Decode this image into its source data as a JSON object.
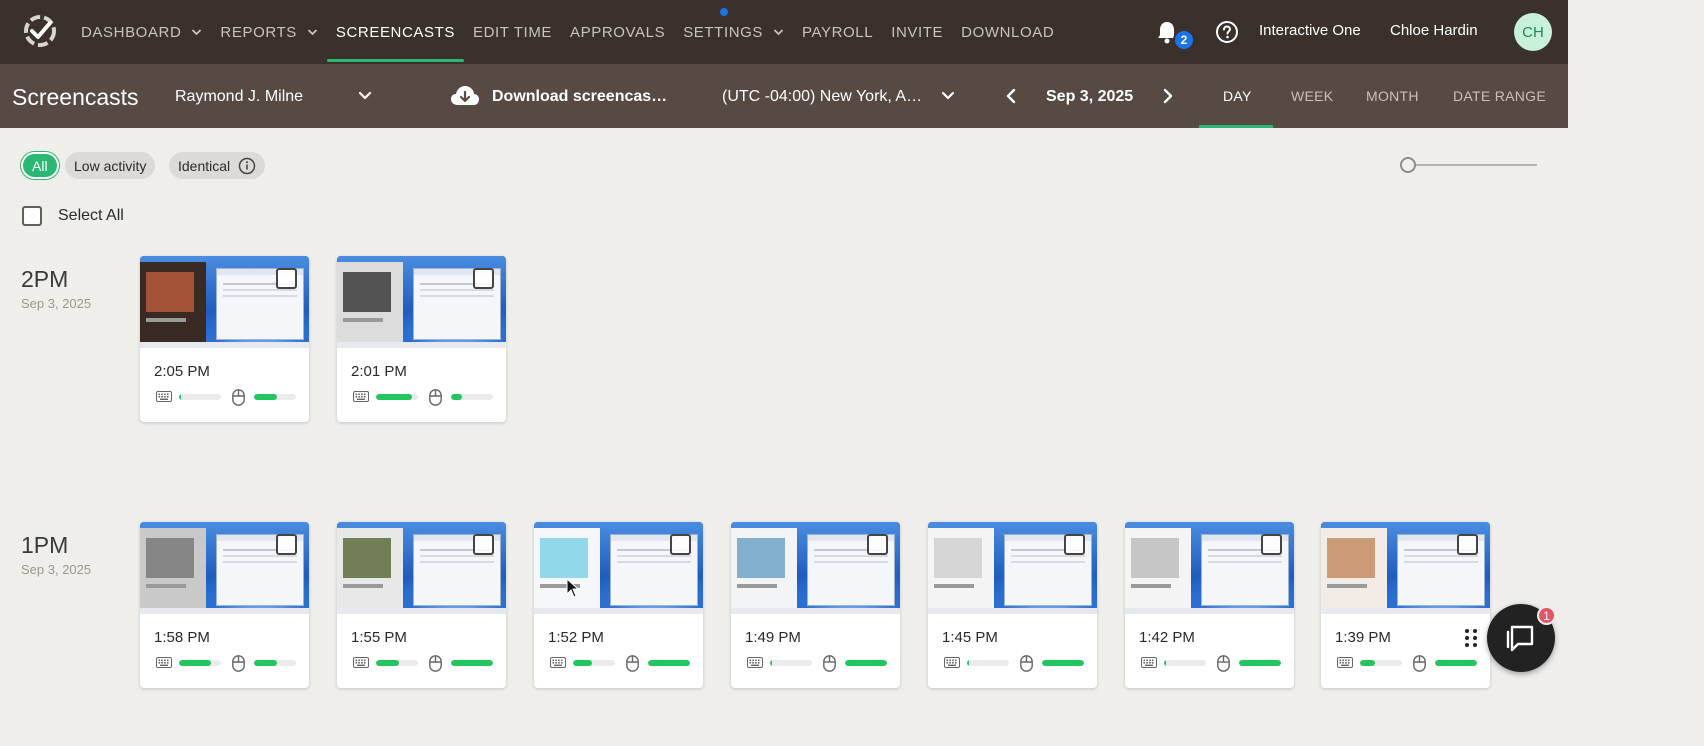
{
  "nav": {
    "items": [
      {
        "label": "DASHBOARD",
        "dropdown": true,
        "active": false
      },
      {
        "label": "REPORTS",
        "dropdown": true,
        "active": false
      },
      {
        "label": "SCREENCASTS",
        "dropdown": false,
        "active": true
      },
      {
        "label": "EDIT TIME",
        "dropdown": false,
        "active": false
      },
      {
        "label": "APPROVALS",
        "dropdown": false,
        "active": false
      },
      {
        "label": "SETTINGS",
        "dropdown": true,
        "active": false
      },
      {
        "label": "PAYROLL",
        "dropdown": false,
        "active": false
      },
      {
        "label": "INVITE",
        "dropdown": false,
        "active": false
      },
      {
        "label": "DOWNLOAD",
        "dropdown": false,
        "active": false
      }
    ],
    "notifications_count": "2",
    "organization": "Interactive One",
    "user_name": "Chloe Hardin",
    "avatar_initials": "CH"
  },
  "subheader": {
    "title": "Screencasts",
    "member": "Raymond J. Milne",
    "download_label": "Download screencas…",
    "timezone": "(UTC -04:00) New York, A…",
    "date": "Sep 3, 2025",
    "range_tabs": [
      "DAY",
      "WEEK",
      "MONTH",
      "DATE RANGE"
    ],
    "active_range": "DAY"
  },
  "filters": {
    "chips": [
      "All",
      "Low activity",
      "Identical"
    ],
    "active_chip": "All",
    "select_all_label": "Select All"
  },
  "groups": [
    {
      "hour": "2PM",
      "date": "Sep 3, 2025",
      "cards": [
        {
          "time": "2:05 PM",
          "keyboard": 0.05,
          "mouse": 0.55
        },
        {
          "time": "2:01 PM",
          "keyboard": 0.85,
          "mouse": 0.25
        }
      ]
    },
    {
      "hour": "1PM",
      "date": "Sep 3, 2025",
      "cards": [
        {
          "time": "1:58 PM",
          "keyboard": 0.75,
          "mouse": 0.55
        },
        {
          "time": "1:55 PM",
          "keyboard": 0.55,
          "mouse": 1.0
        },
        {
          "time": "1:52 PM",
          "keyboard": 0.45,
          "mouse": 1.0
        },
        {
          "time": "1:49 PM",
          "keyboard": 0.05,
          "mouse": 1.0
        },
        {
          "time": "1:45 PM",
          "keyboard": 0.05,
          "mouse": 1.0
        },
        {
          "time": "1:42 PM",
          "keyboard": 0.05,
          "mouse": 1.0
        },
        {
          "time": "1:39 PM",
          "keyboard": 0.35,
          "mouse": 1.0
        }
      ]
    }
  ],
  "chat": {
    "unread_count": "1"
  },
  "colors": {
    "nav_bg": "#3a302c",
    "subbar_bg": "#574a43",
    "accent_green": "#2bb673",
    "activity_green": "#22c55e",
    "badge_blue": "#1a73e8",
    "page_bg": "#efeeeb"
  },
  "icons": {
    "logo": "checkmark-gear-logo",
    "bell": "bell-icon",
    "help": "help-circle-icon",
    "download": "cloud-download-icon",
    "keyboard": "keyboard-icon",
    "mouse": "mouse-icon",
    "chat": "chat-icon",
    "drag": "drag-handle-icon"
  }
}
